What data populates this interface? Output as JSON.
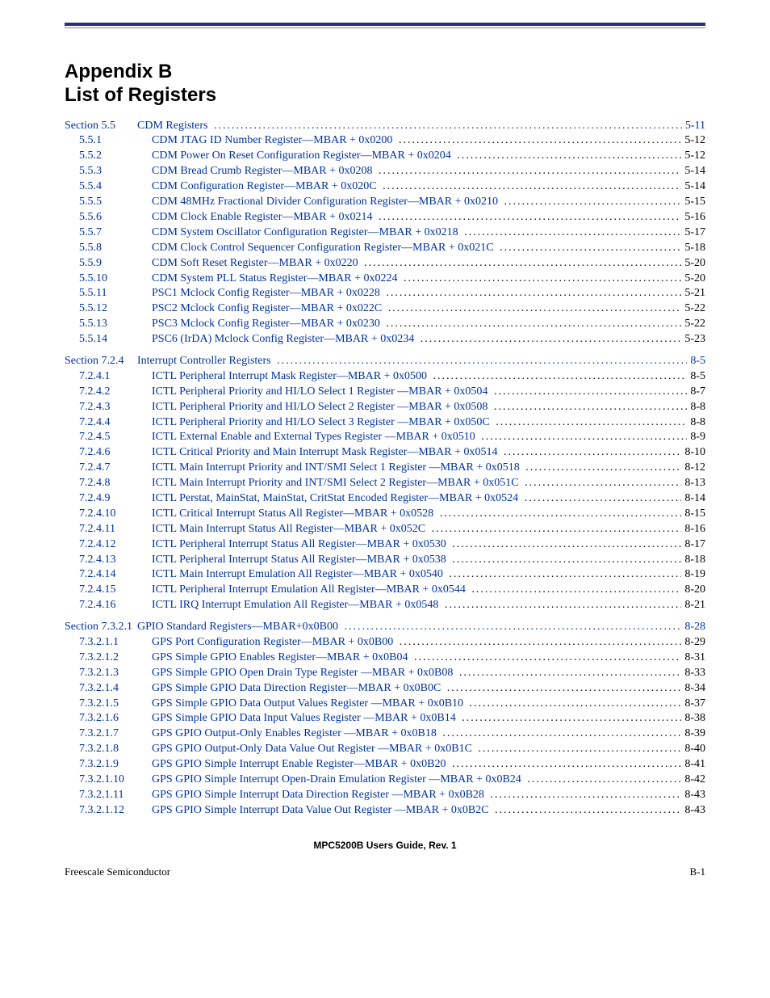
{
  "heading": {
    "line1": "Appendix B",
    "line2": "List of Registers"
  },
  "toc": [
    {
      "section": true,
      "num": "Section 5.5",
      "title": "CDM Registers",
      "page": "5-11"
    },
    {
      "num": "5.5.1",
      "title": "CDM JTAG ID Number Register—MBAR + 0x0200",
      "page": "5-12"
    },
    {
      "num": "5.5.2",
      "title": "CDM Power On Reset Configuration Register—MBAR + 0x0204",
      "page": "5-12"
    },
    {
      "num": "5.5.3",
      "title": "CDM Bread Crumb Register—MBAR + 0x0208",
      "page": "5-14"
    },
    {
      "num": "5.5.4",
      "title": "CDM Configuration Register—MBAR + 0x020C",
      "page": "5-14"
    },
    {
      "num": "5.5.5",
      "title": "CDM 48MHz Fractional Divider Configuration Register—MBAR + 0x0210",
      "page": "5-15"
    },
    {
      "num": "5.5.6",
      "title": "CDM Clock Enable Register—MBAR + 0x0214",
      "page": "5-16"
    },
    {
      "num": "5.5.7",
      "title": "CDM System Oscillator Configuration Register—MBAR + 0x0218",
      "page": "5-17"
    },
    {
      "num": "5.5.8",
      "title": "CDM Clock Control Sequencer Configuration Register—MBAR + 0x021C",
      "page": "5-18"
    },
    {
      "num": "5.5.9",
      "title": "CDM Soft Reset Register—MBAR + 0x0220",
      "page": "5-20"
    },
    {
      "num": "5.5.10",
      "title": "CDM System PLL Status Register—MBAR + 0x0224",
      "page": "5-20"
    },
    {
      "num": "5.5.11",
      "title": "PSC1 Mclock Config Register—MBAR + 0x0228",
      "page": "5-21"
    },
    {
      "num": "5.5.12",
      "title": "PSC2 Mclock Config Register—MBAR + 0x022C",
      "page": "5-22"
    },
    {
      "num": "5.5.13",
      "title": "PSC3 Mclock Config Register—MBAR + 0x0230",
      "page": "5-22"
    },
    {
      "num": "5.5.14",
      "title": "PSC6 (IrDA) Mclock Config Register—MBAR + 0x0234",
      "page": "5-23"
    },
    {
      "gap": true
    },
    {
      "section": true,
      "num": "Section 7.2.4",
      "title": "Interrupt Controller Registers",
      "page": "8-5"
    },
    {
      "num": "7.2.4.1",
      "title": "ICTL Peripheral Interrupt Mask Register—MBAR + 0x0500",
      "page": "8-5"
    },
    {
      "num": "7.2.4.2",
      "title": "ICTL Peripheral Priority and HI/LO Select 1 Register —MBAR + 0x0504",
      "page": "8-7"
    },
    {
      "num": "7.2.4.3",
      "title": "ICTL Peripheral Priority and HI/LO Select 2 Register —MBAR + 0x0508",
      "page": "8-8"
    },
    {
      "num": "7.2.4.4",
      "title": "ICTL Peripheral Priority and HI/LO Select 3 Register —MBAR + 0x050C",
      "page": "8-8"
    },
    {
      "num": "7.2.4.5",
      "title": "ICTL External Enable and External Types Register —MBAR + 0x0510",
      "page": "8-9"
    },
    {
      "num": "7.2.4.6",
      "title": "ICTL Critical Priority and Main Interrupt Mask Register—MBAR + 0x0514",
      "page": "8-10"
    },
    {
      "num": "7.2.4.7",
      "title": "ICTL Main Interrupt Priority and INT/SMI Select 1 Register —MBAR + 0x0518",
      "page": "8-12"
    },
    {
      "num": "7.2.4.8",
      "title": "ICTL Main Interrupt Priority and INT/SMI Select 2 Register—MBAR + 0x051C",
      "page": "8-13"
    },
    {
      "num": "7.2.4.9",
      "title": "ICTL Perstat, MainStat, MainStat, CritStat Encoded Register—MBAR + 0x0524",
      "page": "8-14"
    },
    {
      "num": "7.2.4.10",
      "title": "ICTL Critical Interrupt Status All Register—MBAR + 0x0528",
      "page": "8-15"
    },
    {
      "num": "7.2.4.11",
      "title": "ICTL Main Interrupt Status All Register—MBAR + 0x052C",
      "page": "8-16"
    },
    {
      "num": "7.2.4.12",
      "title": "ICTL Peripheral Interrupt Status All Register—MBAR + 0x0530",
      "page": "8-17"
    },
    {
      "num": "7.2.4.13",
      "title": "ICTL Peripheral Interrupt Status All Register—MBAR + 0x0538",
      "page": "8-18"
    },
    {
      "num": "7.2.4.14",
      "title": "ICTL Main Interrupt Emulation All Register—MBAR + 0x0540",
      "page": "8-19"
    },
    {
      "num": "7.2.4.15",
      "title": "ICTL Peripheral Interrupt Emulation All Register—MBAR + 0x0544",
      "page": "8-20"
    },
    {
      "num": "7.2.4.16",
      "title": "ICTL IRQ Interrupt Emulation All Register—MBAR + 0x0548",
      "page": "8-21"
    },
    {
      "gap": true
    },
    {
      "section": true,
      "num": "Section 7.3.2.1",
      "title": "GPIO Standard Registers—MBAR+0x0B00",
      "page": "8-28"
    },
    {
      "num": "7.3.2.1.1",
      "title": "GPS Port Configuration Register—MBAR + 0x0B00",
      "page": "8-29"
    },
    {
      "num": "7.3.2.1.2",
      "title": "GPS Simple GPIO Enables Register—MBAR + 0x0B04",
      "page": "8-31"
    },
    {
      "num": "7.3.2.1.3",
      "title": "GPS Simple GPIO Open Drain Type Register —MBAR + 0x0B08",
      "page": "8-33"
    },
    {
      "num": "7.3.2.1.4",
      "title": "GPS Simple GPIO Data Direction Register—MBAR + 0x0B0C",
      "page": "8-34"
    },
    {
      "num": "7.3.2.1.5",
      "title": "GPS Simple GPIO Data Output Values Register —MBAR + 0x0B10",
      "page": "8-37"
    },
    {
      "num": "7.3.2.1.6",
      "title": "GPS Simple GPIO Data Input Values Register —MBAR + 0x0B14",
      "page": "8-38"
    },
    {
      "num": "7.3.2.1.7",
      "title": "GPS GPIO Output-Only Enables Register —MBAR + 0x0B18",
      "page": "8-39"
    },
    {
      "num": "7.3.2.1.8",
      "title": "GPS GPIO Output-Only Data Value Out Register —MBAR + 0x0B1C",
      "page": "8-40"
    },
    {
      "num": "7.3.2.1.9",
      "title": "GPS GPIO Simple Interrupt Enable Register—MBAR + 0x0B20",
      "page": "8-41"
    },
    {
      "num": "7.3.2.1.10",
      "title": "GPS GPIO Simple Interrupt Open-Drain Emulation Register —MBAR + 0x0B24",
      "page": "8-42"
    },
    {
      "num": "7.3.2.1.11",
      "title": "GPS GPIO Simple Interrupt Data Direction Register —MBAR + 0x0B28",
      "page": "8-43"
    },
    {
      "num": "7.3.2.1.12",
      "title": "GPS GPIO Simple Interrupt Data Value Out Register —MBAR + 0x0B2C",
      "page": "8-43"
    }
  ],
  "footer": {
    "doc_id": "MPC5200B Users Guide, Rev. 1",
    "left": "Freescale Semiconductor",
    "right": "B-1"
  }
}
